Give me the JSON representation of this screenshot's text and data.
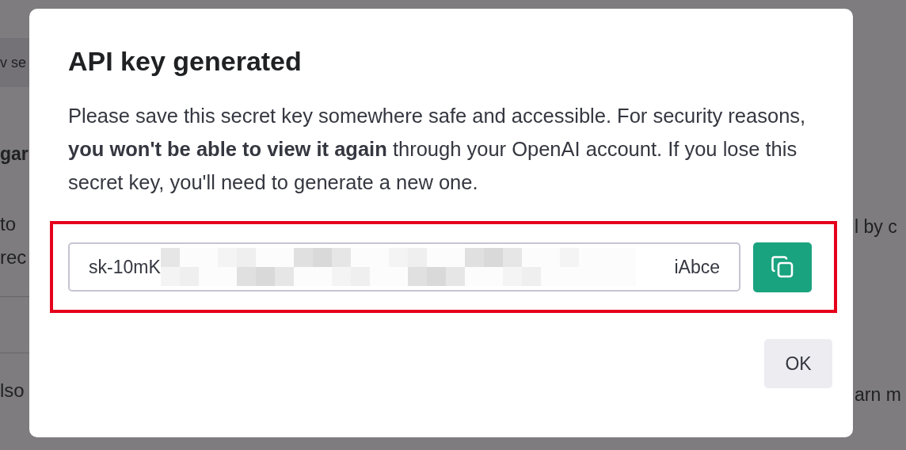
{
  "background_page": {
    "left_fragments": [
      {
        "kind": "button",
        "text": "v se"
      },
      {
        "kind": "heading",
        "text": "gar"
      },
      {
        "kind": "text",
        "text": "to"
      },
      {
        "kind": "text",
        "text": "rec"
      },
      {
        "kind": "divider"
      },
      {
        "kind": "divider"
      },
      {
        "kind": "text",
        "text": "lso"
      }
    ],
    "right_fragments": [
      {
        "kind": "text",
        "text": "l by c"
      },
      {
        "kind": "text",
        "text": "arn m"
      }
    ]
  },
  "dialog": {
    "title": "API key generated",
    "message": "Please save this secret key somewhere safe and accessible. For security reasons, **you won't be able to view it again** through your OpenAI account. If you lose this secret key, you'll need to generate a new one.",
    "key_field": {
      "visible_start": "sk-10mK",
      "visible_end": "iAbce",
      "redacted": true,
      "highlighted": true
    },
    "buttons": [
      {
        "kind": "copy"
      },
      {
        "kind": "text",
        "label": "OK"
      }
    ]
  }
}
